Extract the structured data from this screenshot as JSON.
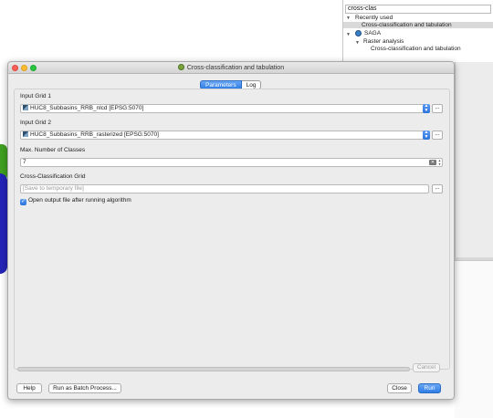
{
  "toolbox": {
    "search_value": "cross-clas",
    "recently_used_label": "Recently used",
    "recent_item": "Cross-classification and tabulation",
    "saga_label": "SAGA",
    "raster_analysis_label": "Raster analysis",
    "saga_item": "Cross-classification and tabulation"
  },
  "dialog": {
    "title": "Cross-classification and tabulation",
    "tabs": [
      {
        "label": "Parameters",
        "active": true
      },
      {
        "label": "Log",
        "active": false
      }
    ],
    "input_grid_1": {
      "label": "Input Grid 1",
      "value": "HUC8_Subbasins_RRB_nlcd [EPSG:5070]"
    },
    "input_grid_2": {
      "label": "Input Grid 2",
      "value": "HUC8_Subbasins_RRB_rasterized [EPSG:5070]"
    },
    "max_classes": {
      "label": "Max. Number of Classes",
      "value": "7"
    },
    "output_grid": {
      "label": "Cross-Classification Grid",
      "placeholder": "[Save to temporary file]"
    },
    "open_output": {
      "label": "Open output file after running algorithm",
      "checked": true
    },
    "browse_label": "...",
    "progress": 0,
    "buttons": {
      "cancel": "Cancel",
      "help": "Help",
      "batch": "Run as Batch Process...",
      "close": "Close",
      "run": "Run"
    }
  },
  "colors": {
    "accent": "#2f7ee6",
    "dialog_bg": "#ececec"
  }
}
